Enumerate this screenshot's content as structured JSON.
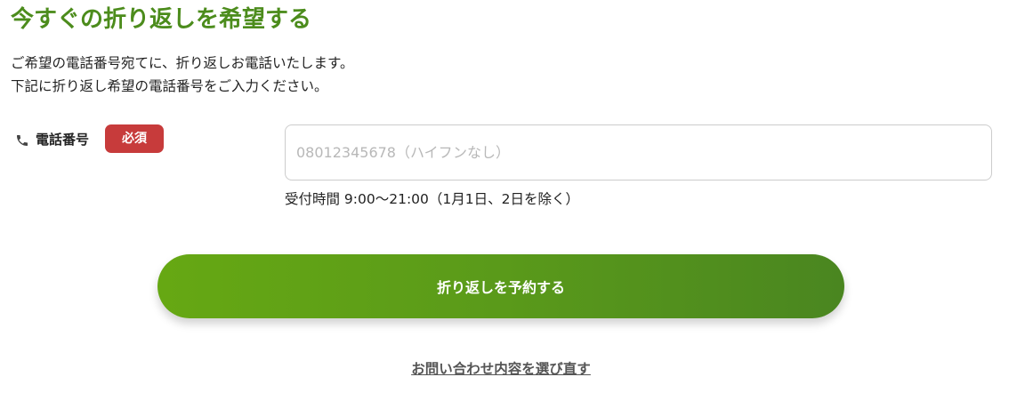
{
  "heading": "今すぐの折り返しを希望する",
  "description": {
    "line1": "ご希望の電話番号宛てに、折り返しお電話いたします。",
    "line2": "下記に折り返し希望の電話番号をご入力ください。"
  },
  "phone_field": {
    "icon": "phone-icon",
    "label": "電話番号",
    "required_badge": "必須",
    "placeholder": "08012345678（ハイフンなし）",
    "value": ""
  },
  "hours_note": "受付時間 9:00〜21:00（1月1日、2日を除く）",
  "submit_label": "折り返しを予約する",
  "reselect_link": "お問い合わせ内容を選び直す",
  "colors": {
    "heading": "#4c8c1c",
    "badge": "#c73b3b",
    "button_start": "#66a813",
    "button_end": "#4a8620"
  }
}
